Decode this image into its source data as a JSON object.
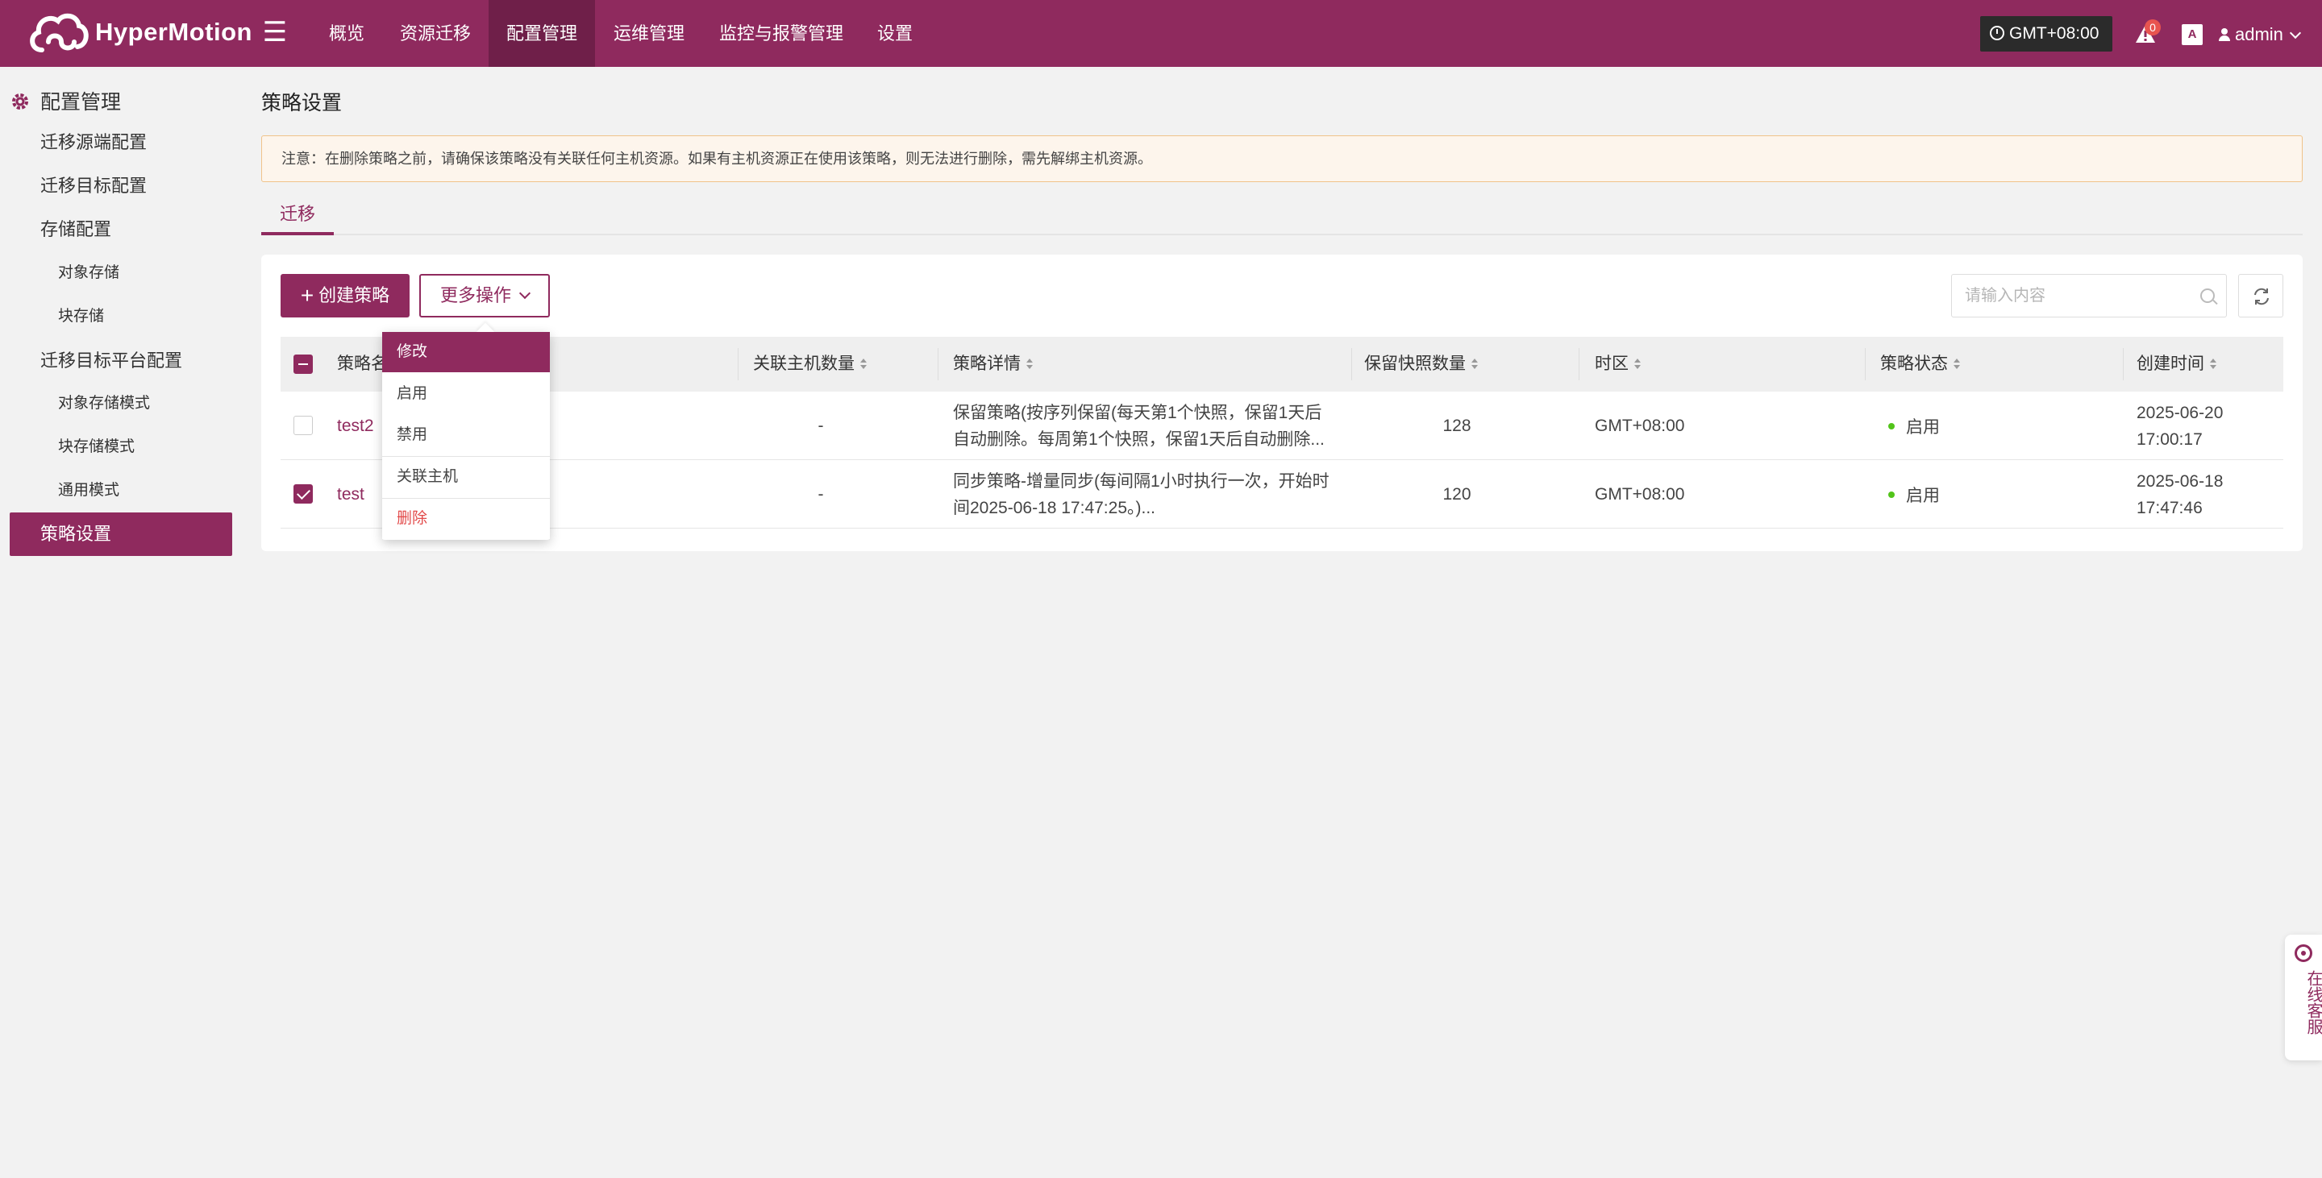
{
  "app": {
    "brand": "HyperMotion",
    "timezone": "GMT+08:00",
    "alert_count": "0",
    "user": "admin",
    "lang_icon": "A"
  },
  "nav": {
    "items": [
      {
        "label": "概览"
      },
      {
        "label": "资源迁移"
      },
      {
        "label": "配置管理",
        "active": true
      },
      {
        "label": "运维管理"
      },
      {
        "label": "监控与报警管理"
      },
      {
        "label": "设置"
      }
    ]
  },
  "sidebar": {
    "title": "配置管理",
    "items": [
      {
        "label": "迁移源端配置"
      },
      {
        "label": "迁移目标配置"
      },
      {
        "label": "存储配置"
      },
      {
        "label": "对象存储"
      },
      {
        "label": "块存储"
      },
      {
        "label": "迁移目标平台配置"
      },
      {
        "label": "对象存储模式"
      },
      {
        "label": "块存储模式"
      },
      {
        "label": "通用模式"
      },
      {
        "label": "策略设置",
        "active": true
      }
    ]
  },
  "page": {
    "title": "策略设置",
    "notice": "注意：在删除策略之前，请确保该策略没有关联任何主机资源。如果有主机资源正在使用该策略，则无法进行删除，需先解绑主机资源。",
    "tab": "迁移"
  },
  "toolbar": {
    "create_label": "创建策略",
    "more_label": "更多操作",
    "search_placeholder": "请输入内容"
  },
  "table": {
    "headers": [
      "策略名称",
      "关联主机数量",
      "策略详情",
      "保留快照数量",
      "时区",
      "策略状态",
      "创建时间"
    ],
    "rows": [
      {
        "checked": false,
        "name": "test2",
        "hosts": "-",
        "detail_1": "保留策略(按序列保留(每天第1个快照，保留1天后",
        "detail_2": "自动删除。每周第1个快照，保留1天后自动删除...",
        "snapshots": "128",
        "timezone": "GMT+08:00",
        "status": "启用",
        "created_date": "2025-06-20",
        "created_time": "17:00:17"
      },
      {
        "checked": true,
        "name": "test",
        "hosts": "-",
        "detail_1": "同步策略-增量同步(每间隔1小时执行一次，开始时",
        "detail_2": "间2025-06-18 17:47:25。)...",
        "snapshots": "120",
        "timezone": "GMT+08:00",
        "status": "启用",
        "created_date": "2025-06-18",
        "created_time": "17:47:46"
      }
    ]
  },
  "dropdown": {
    "items": [
      "修改",
      "启用",
      "禁用",
      "关联主机",
      "删除"
    ]
  },
  "support": {
    "label": "在线客服"
  },
  "colors": {
    "brand": "#8f2a5e",
    "nav_active": "#6f1f49",
    "danger": "#e24a4a",
    "status_on": "#52c41a"
  }
}
